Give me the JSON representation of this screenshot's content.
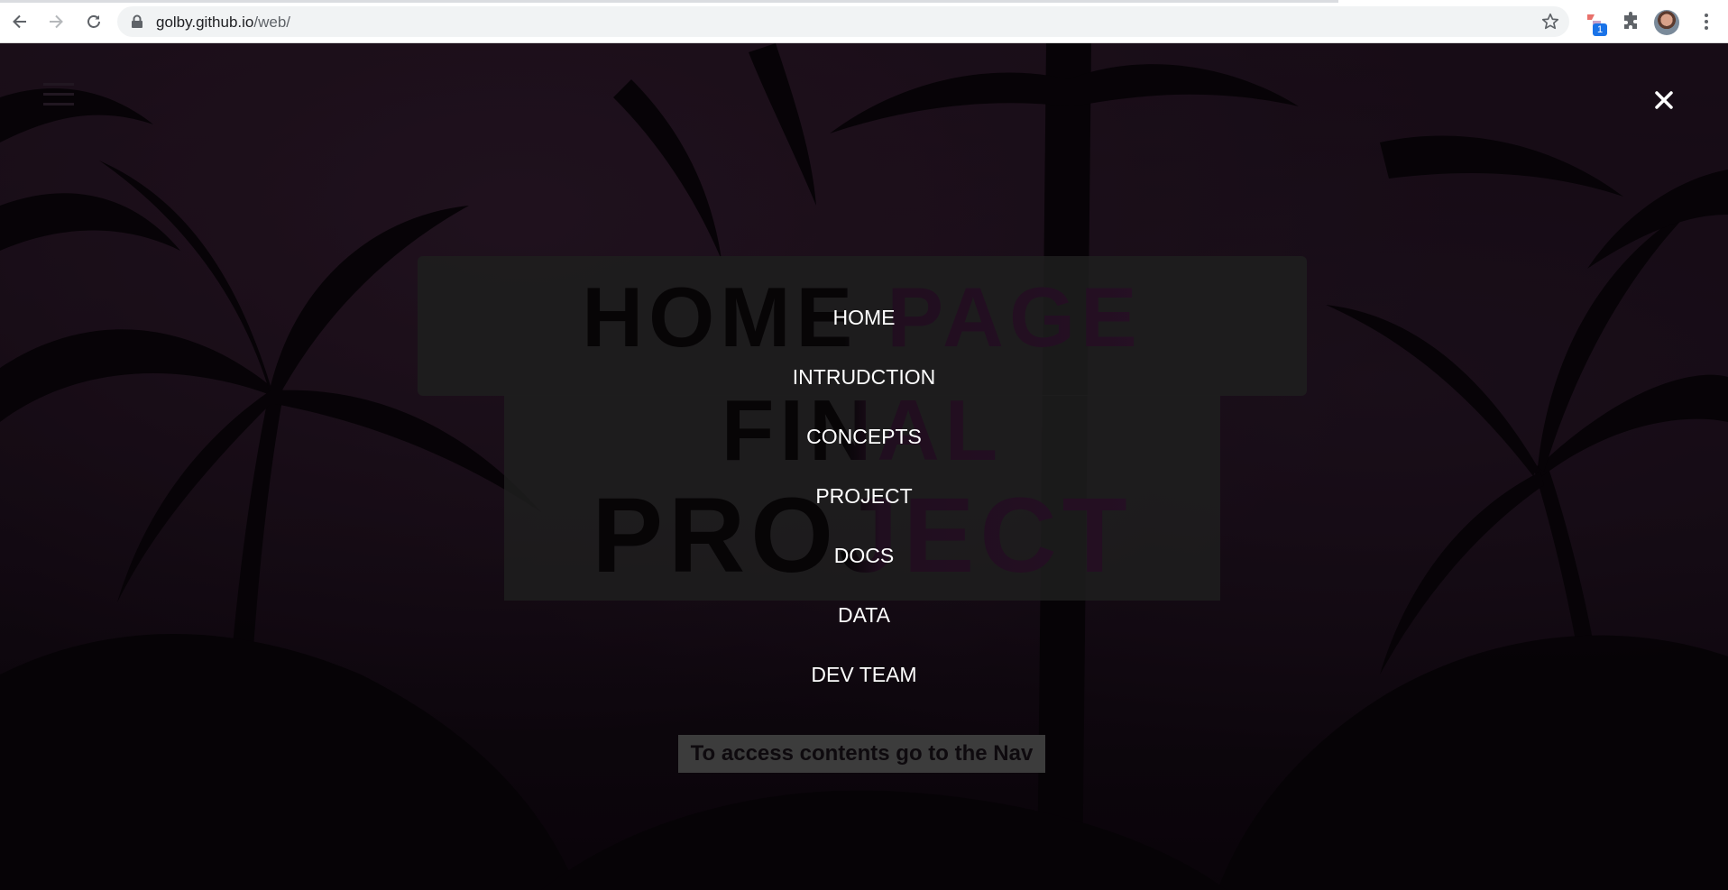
{
  "browser": {
    "url_host": "golby.github.io",
    "url_path": "/web/",
    "extension_badge": "1",
    "icons": [
      "back-arrow-icon",
      "forward-arrow-icon",
      "reload-icon",
      "lock-icon",
      "star-icon",
      "extension-icon",
      "puzzle-icon",
      "profile-avatar",
      "kebab-menu-icon"
    ]
  },
  "page": {
    "hero": {
      "line1": "HOME PAGE",
      "line2": "FINAL",
      "line3": "PROJECT"
    },
    "nav_menu": {
      "items": [
        {
          "label": "HOME"
        },
        {
          "label": "INTRUDCTION"
        },
        {
          "label": "CONCEPTS"
        },
        {
          "label": "PROJECT"
        },
        {
          "label": "DOCS"
        },
        {
          "label": "DATA"
        },
        {
          "label": "DEV TEAM"
        }
      ],
      "close_icon": "close-icon"
    },
    "notice": "To access contents go to the Nav",
    "menu_icon": "hamburger-menu-icon"
  },
  "colors": {
    "overlay": "#000000",
    "menu_text": "#ffffff",
    "hero_panel": "#373737",
    "accent_purple": "#4a2045"
  }
}
